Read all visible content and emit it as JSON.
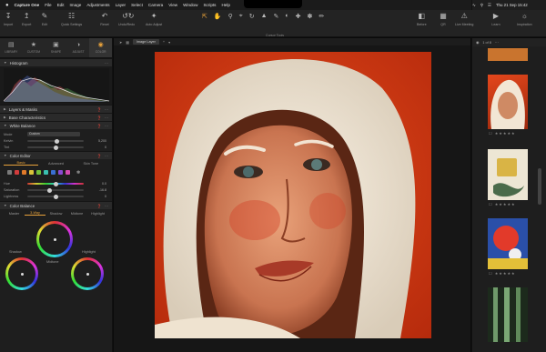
{
  "menubar": {
    "apple": "",
    "app": "Capture One",
    "items": [
      "File",
      "Edit",
      "Image",
      "Adjustments",
      "Layer",
      "Select",
      "Camera",
      "View",
      "Window",
      "Scripts",
      "Help"
    ],
    "clock": "Thu 21 Sep 15:42"
  },
  "toolbar": {
    "import": "Import",
    "export": "Export",
    "edit": "Edit",
    "quick_settings": "Quick Settings",
    "reset": "Reset",
    "undo_redo": "Undo/Redo",
    "auto_adjust": "Auto Adjust",
    "cursor_tools": "Cursor Tools",
    "before": "Before",
    "qr": "QR",
    "live_meeting": "Live Meeting",
    "learn": "Learn",
    "inspiration": "Inspiration"
  },
  "tooltabs": [
    {
      "label": "LIBRARY",
      "icon": "library-icon"
    },
    {
      "label": "CUSTOM",
      "icon": "custom-icon"
    },
    {
      "label": "SHAPE",
      "icon": "shape-icon"
    },
    {
      "label": "ADJUST",
      "icon": "adjust-icon"
    },
    {
      "label": "COLOR",
      "icon": "color-icon"
    }
  ],
  "sections": {
    "histogram": "Histogram",
    "layers": "Layers & Masks",
    "base": "Base Characteristics",
    "white_balance": "White Balance",
    "color_editor": "Color Editor",
    "color_balance": "Color Balance"
  },
  "white_balance": {
    "mode_label": "Mode",
    "mode_value": "Custom",
    "kelvin_label": "Kelvin",
    "kelvin_value": "5,200",
    "tint_label": "Tint",
    "tint_value": "0"
  },
  "color_editor": {
    "tabs": [
      "Basic",
      "Advanced",
      "Skin Tone"
    ],
    "swatches": [
      "#7a7a7a",
      "#d23c3c",
      "#e07a2a",
      "#d9c43a",
      "#6fbf3a",
      "#3ac0b0",
      "#3a6fd2",
      "#8a4ad2",
      "#d24ab0"
    ],
    "hue_label": "Hue",
    "hue_value": "0.0",
    "saturation_label": "Saturation",
    "saturation_value": "-16.8",
    "lightness_label": "Lightness",
    "lightness_value": "0"
  },
  "color_balance": {
    "tabs": [
      "Master",
      "3-Way",
      "Shadow",
      "Midtone",
      "Highlight"
    ],
    "shadow": "Shadow",
    "midtone": "Midtone",
    "highlight": "Highlight"
  },
  "viewer": {
    "layer": "Image Layer"
  },
  "browser": {
    "count": "1 of 8"
  }
}
